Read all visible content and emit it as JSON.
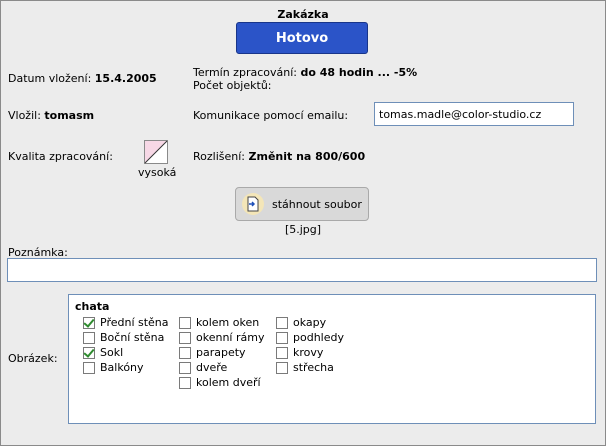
{
  "order": {
    "title": "Zakázka",
    "status_label": "Hotovo"
  },
  "fields": {
    "date_label": "Datum vložení:",
    "date_value": "15.4.2005",
    "deadline_label": "Termín zpracování:",
    "deadline_value": "do 48 hodin ... -5%",
    "object_count_label": "Počet objektů:",
    "author_label": "Vložil:",
    "author_value": "tomasm",
    "email_label": "Komunikace pomocí emailu:",
    "email_value": "tomas.madle@color-studio.cz",
    "quality_label": "Kvalita zpracování:",
    "quality_value": "vysoká",
    "resolution_label": "Rozlišení:",
    "resolution_value": "Změnit na 800/600"
  },
  "download": {
    "label": "stáhnout soubor",
    "filename": "[5.jpg]"
  },
  "note": {
    "label": "Poznámka:",
    "value": ""
  },
  "image": {
    "label": "Obrázek:",
    "group_title": "chata",
    "columns": [
      [
        {
          "label": "Přední stěna",
          "checked": true
        },
        {
          "label": "Boční stěna",
          "checked": false
        },
        {
          "label": "Sokl",
          "checked": true
        },
        {
          "label": "Balkóny",
          "checked": false
        }
      ],
      [
        {
          "label": "kolem oken",
          "checked": false
        },
        {
          "label": "okenní rámy",
          "checked": false
        },
        {
          "label": "parapety",
          "checked": false
        },
        {
          "label": "dveře",
          "checked": false
        },
        {
          "label": "kolem dveří",
          "checked": false
        }
      ],
      [
        {
          "label": "okapy",
          "checked": false
        },
        {
          "label": "podhledy",
          "checked": false
        },
        {
          "label": "krovy",
          "checked": false
        },
        {
          "label": "střecha",
          "checked": false
        }
      ]
    ]
  },
  "colors": {
    "status_button": "#2b54c8",
    "input_border": "#6e8fb8",
    "check_mark": "#2e8b2e"
  }
}
